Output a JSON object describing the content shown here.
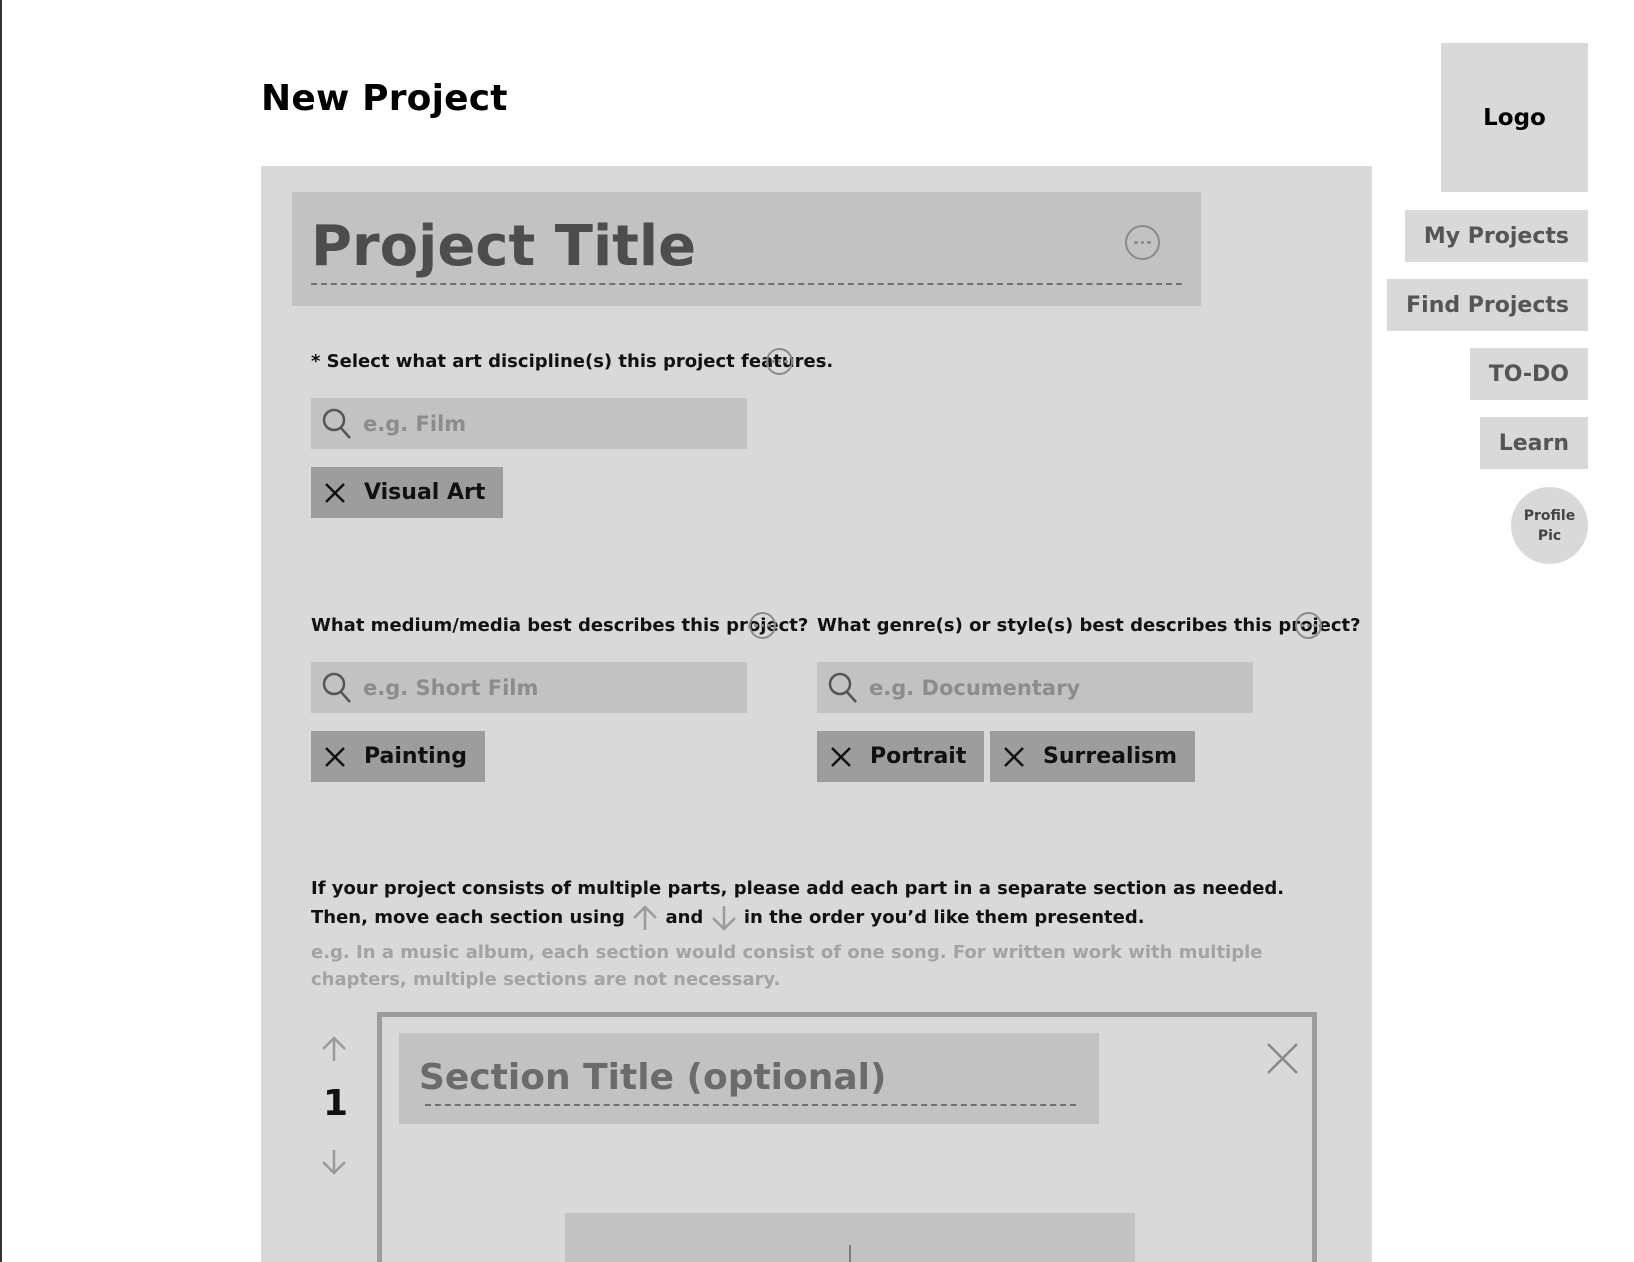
{
  "page": {
    "title": "New Project"
  },
  "nav": {
    "logo": "Logo",
    "items": [
      {
        "label": "My Projects"
      },
      {
        "label": "Find Projects"
      },
      {
        "label": "TO-DO"
      },
      {
        "label": "Learn"
      }
    ],
    "profile": "Profile Pic"
  },
  "project": {
    "title_placeholder": "Project Title"
  },
  "discipline": {
    "label": "* Select what art discipline(s) this project features.",
    "placeholder": "e.g. Film",
    "chips": [
      "Visual Art"
    ]
  },
  "medium": {
    "label": "What medium/media best describes this project?",
    "placeholder": "e.g. Short Film",
    "chips": [
      "Painting"
    ]
  },
  "genre": {
    "label": "What genre(s) or style(s) best describes this project?",
    "placeholder": "e.g. Documentary",
    "chips": [
      "Portrait",
      "Surrealism"
    ]
  },
  "sections": {
    "instruction_part1": "If your project consists of multiple parts, please add each part in a separate section as needed. Then, move each section using",
    "instruction_and": "and",
    "instruction_part2": "in the order you’d like them presented.",
    "hint": "e.g. In a music album, each section would consist of one song. For written work with multiple chapters, multiple sections are not necessary.",
    "items": [
      {
        "number": "1",
        "title_placeholder": "Section Title (optional)"
      }
    ]
  },
  "icons": {
    "more": "more-options-icon",
    "search": "search-icon",
    "remove": "close-icon",
    "up": "arrow-up-icon",
    "down": "arrow-down-icon"
  },
  "colors": {
    "panel": "#d9d9d9",
    "field": "#c2c2c2",
    "chip": "#9d9d9d",
    "placeholder": "#8c8c8c"
  }
}
